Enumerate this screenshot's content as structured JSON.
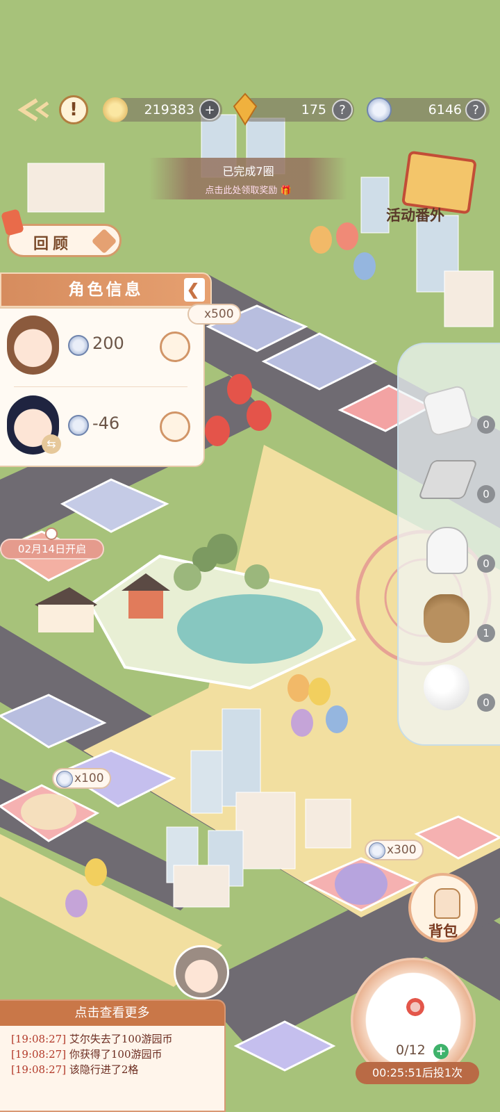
{
  "topbar": {
    "coins": "219383",
    "crystals": "175",
    "tokens": "6146",
    "add_icon": "plus-icon",
    "help_icon": "question-icon",
    "back_icon": "back-arrow-icon",
    "alert_icon": "exclamation-icon"
  },
  "banner": {
    "title": "已完成7圈",
    "subtitle": "点击此处领取奖励"
  },
  "review_button": {
    "label": "回顾"
  },
  "event_label": "活动番外",
  "role_panel": {
    "title": "角色信息",
    "rows": [
      {
        "value": "200"
      },
      {
        "value": "-46"
      }
    ]
  },
  "board": {
    "tags": [
      {
        "text": "x500"
      },
      {
        "text": "x100"
      },
      {
        "text": "x300"
      }
    ],
    "lock_label": "02月14日开启"
  },
  "items": [
    {
      "name": "dice",
      "count": "0"
    },
    {
      "name": "bridge",
      "count": "0"
    },
    {
      "name": "glove",
      "count": "0"
    },
    {
      "name": "money-bag",
      "count": "1"
    },
    {
      "name": "snowball",
      "count": "0"
    }
  ],
  "log": {
    "header": "点击查看更多",
    "lines": [
      {
        "time": "[19:08:27]",
        "text": "艾尔失去了100游园币"
      },
      {
        "time": "[19:08:27]",
        "text": "你获得了100游园币"
      },
      {
        "time": "[19:08:27]",
        "text": "该隐行进了2格"
      }
    ]
  },
  "bag_button": {
    "label": "背包"
  },
  "roll": {
    "count": "0/12",
    "timer": "00:25:51后投1次"
  },
  "colors": {
    "grass": "#a7c27a",
    "road": "#6e6a70",
    "accent": "#d68c5e"
  }
}
